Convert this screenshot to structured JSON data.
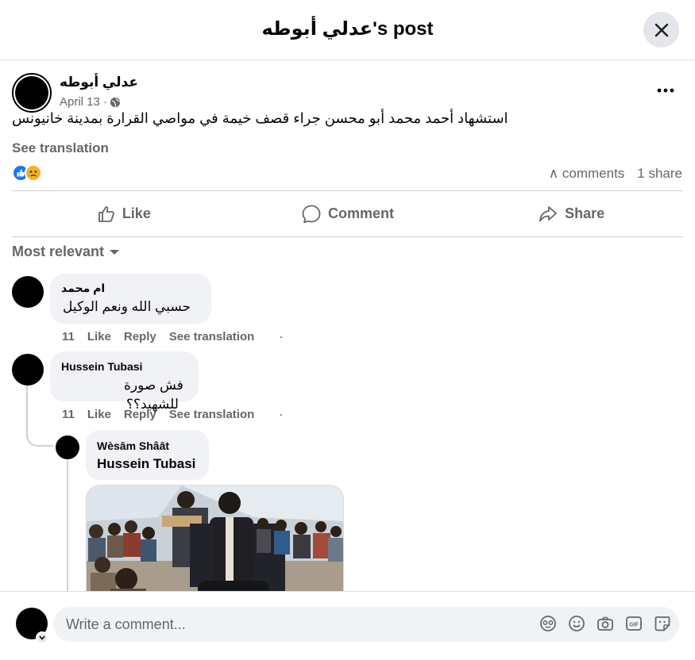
{
  "header": {
    "title": "عدلي أبوطه's post",
    "close_icon": "close-icon"
  },
  "post": {
    "author": "عدلي أبوطه",
    "date": "April 13 ·",
    "privacy_icon": "globe-icon",
    "text": "استشهاد أحمد محمد أبو محسن جراء قصف خيمة في مواصي القرارة بمدينة خانيونس",
    "see_translation": "See translation",
    "reactions": [
      "like",
      "sad"
    ],
    "comments_count": "∧ comments",
    "shares_count": "1 share"
  },
  "actions": {
    "like": "Like",
    "comment": "Comment",
    "share": "Share"
  },
  "sort_label": "Most relevant",
  "comments": [
    {
      "name": "ام محمد",
      "text": "حسبي الله ونعم الوكيل",
      "time": "11",
      "like": "Like",
      "reply": "Reply",
      "see_translation": "See translation",
      "dot": "·"
    },
    {
      "name": "Hussein Tubasi",
      "text_line1": "فش صورة",
      "text_line2": "للشهيد؟؟",
      "time": "11",
      "like": "Like",
      "reply": "Reply",
      "see_translation": "See translation",
      "dot": "·"
    }
  ],
  "reply": {
    "name": "Wèsām Shâāt",
    "mention": "Hussein Tubasi"
  },
  "composer": {
    "placeholder": "Write a comment...",
    "icons": [
      "avatar-sticker-icon",
      "emoji-icon",
      "camera-icon",
      "gif-icon",
      "sticker-icon"
    ]
  },
  "colors": {
    "accent": "#1877f2",
    "secondary_text": "#65676b",
    "bubble": "#f0f2f5"
  }
}
